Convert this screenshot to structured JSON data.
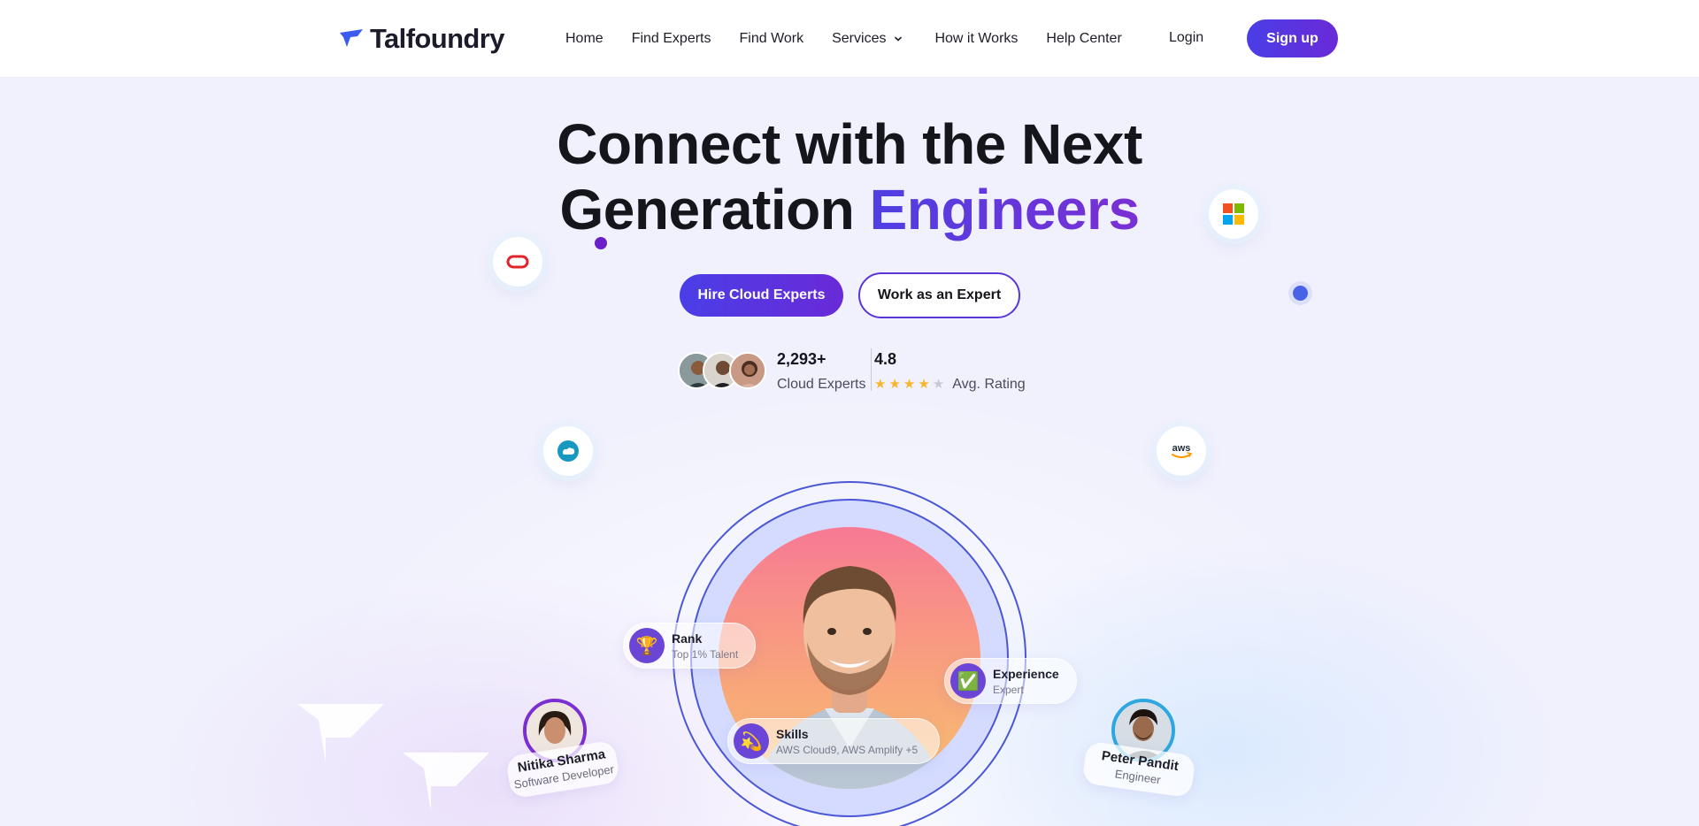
{
  "nav": {
    "logo_text": "Talfoundry",
    "links": [
      "Home",
      "Find Experts",
      "Find Work",
      "Services",
      "How it Works",
      "Help Center"
    ],
    "login": "Login",
    "signup": "Sign up"
  },
  "hero": {
    "headline_line1": "Connect with the Next",
    "headline_line2_prefix": "Generation ",
    "headline_line2_accent": "Engineers",
    "primary_cta": "Hire Cloud Experts",
    "secondary_cta": "Work as an Expert"
  },
  "stats": {
    "experts_count": "2,293+",
    "experts_label": "Cloud Experts",
    "rating_value": "4.8",
    "rating_label": "Avg. Rating",
    "rating_stars": 4
  },
  "brands": [
    "oracle-icon",
    "microsoft-icon",
    "salesforce-icon",
    "aws-icon"
  ],
  "pills": {
    "rank": {
      "title": "Rank",
      "subtitle": "Top 1% Talent",
      "icon": "trophy-icon"
    },
    "experience": {
      "title": "Experience",
      "subtitle": "Expert",
      "icon": "check-icon"
    },
    "skills": {
      "title": "Skills",
      "subtitle": "AWS Cloud9, AWS Amplify +5",
      "icon": "comet-icon"
    }
  },
  "people": [
    {
      "name": "Nitika Sharma",
      "role": "Software Developer"
    },
    {
      "name": "Peter Pandit",
      "role": "Engineer"
    }
  ],
  "colors": {
    "accent": "#5b36d6",
    "accent_gradient_start": "#4a3ee6",
    "accent_gradient_end": "#6a2ad8",
    "background": "#f1f1fd",
    "star": "#f5b728"
  }
}
